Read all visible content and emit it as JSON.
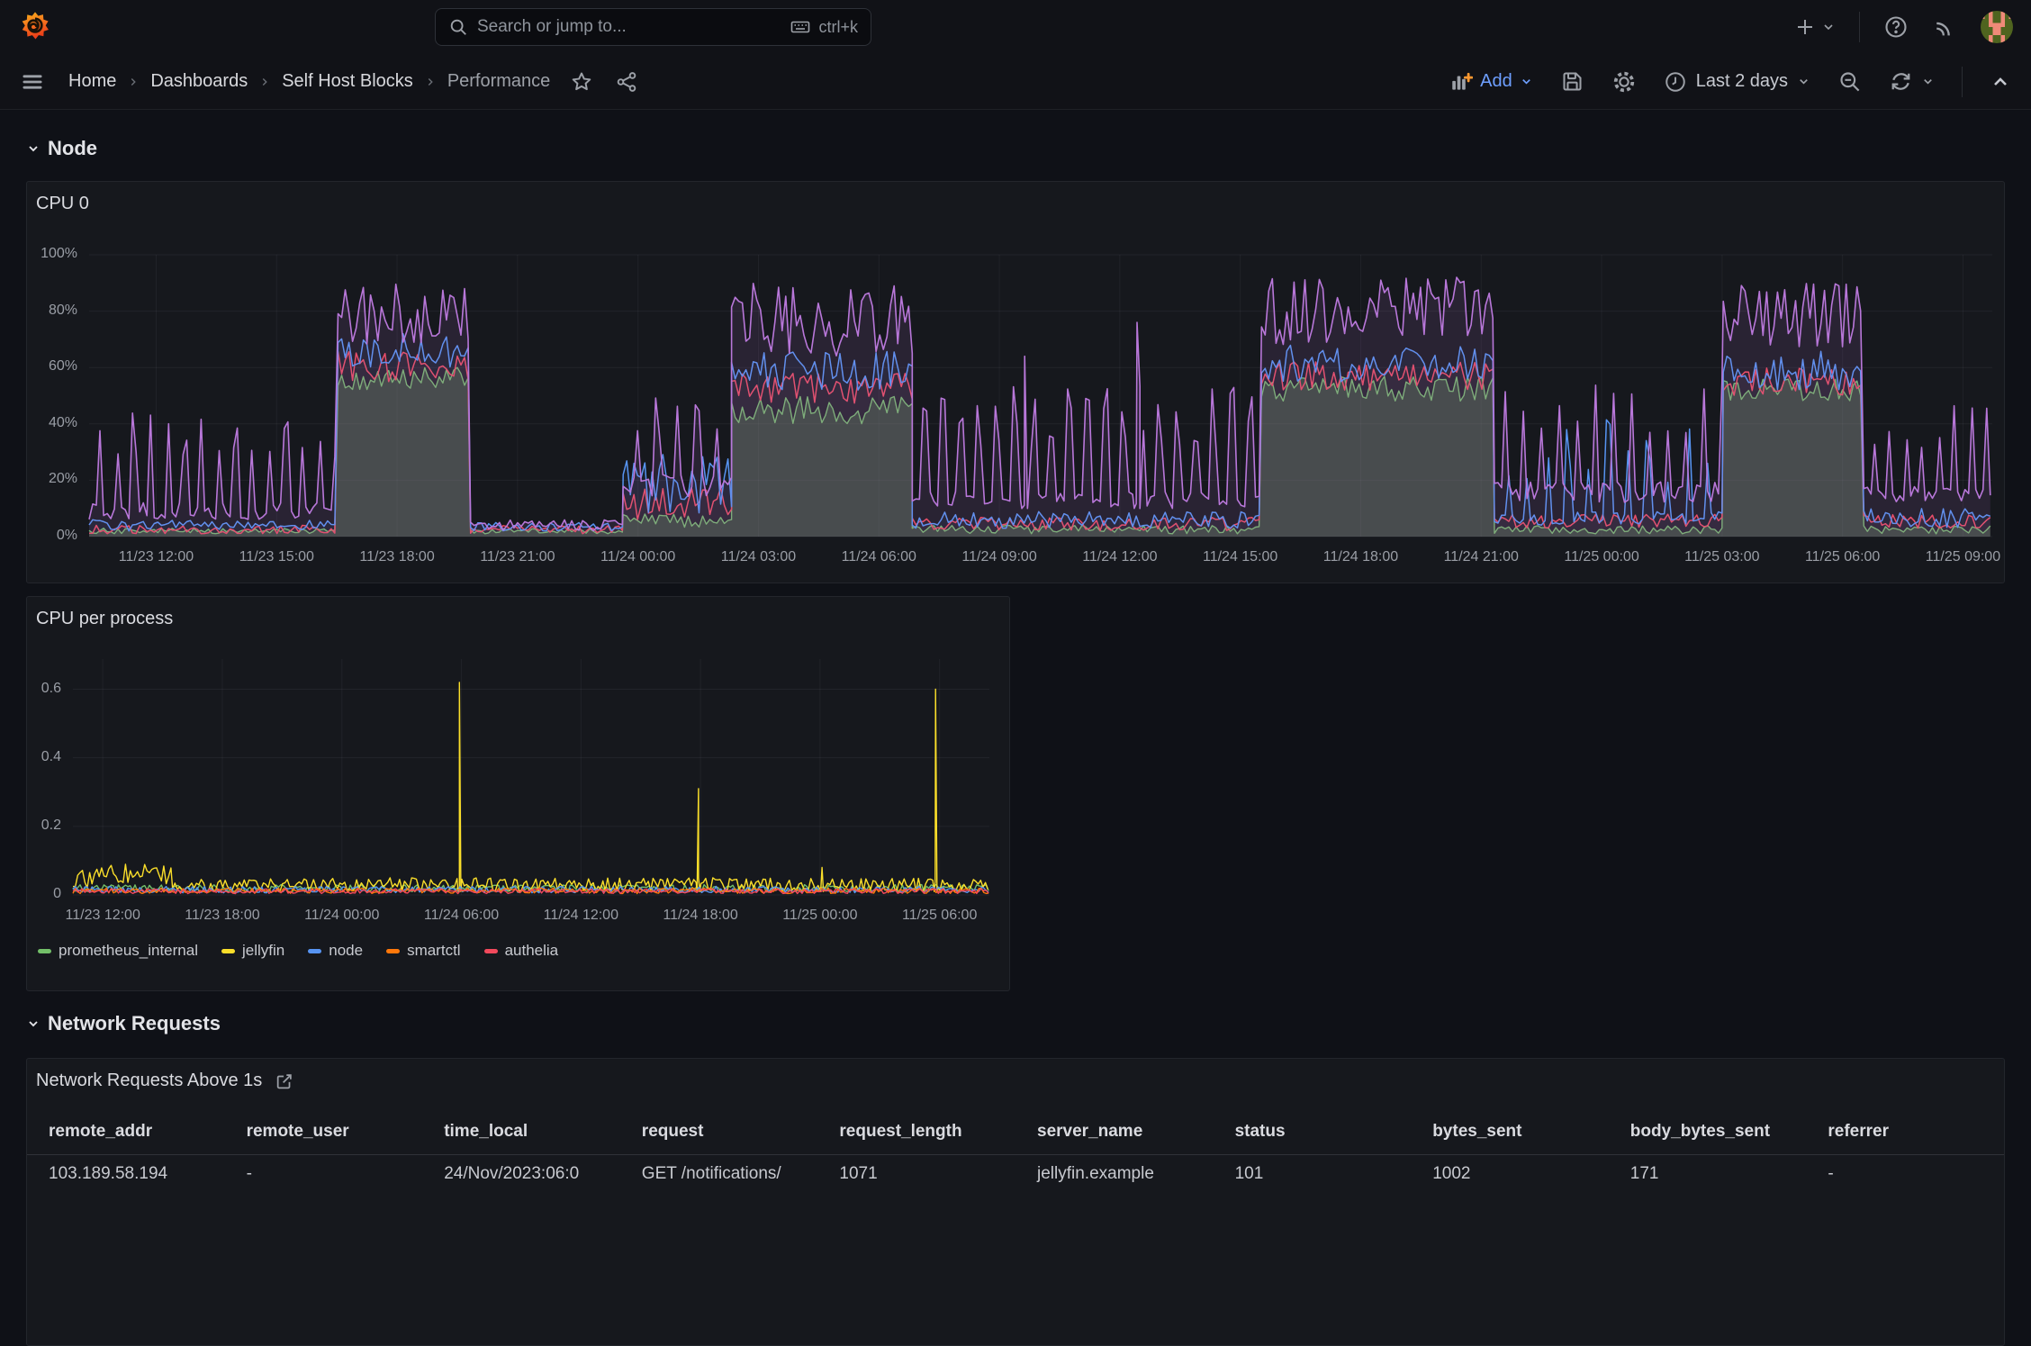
{
  "topbar": {
    "search_placeholder": "Search or jump to...",
    "search_shortcut": "ctrl+k"
  },
  "toolbar": {
    "breadcrumb": [
      "Home",
      "Dashboards",
      "Self Host Blocks",
      "Performance"
    ],
    "add_label": "Add",
    "time_range_label": "Last 2 days"
  },
  "sections": {
    "node": "Node",
    "network": "Network Requests"
  },
  "colors": {
    "accent_blue": "#6e9fff",
    "series_green": "#73BF69",
    "series_yellow": "#FADE2A",
    "series_blue": "#5794F2",
    "series_orange": "#FF780A",
    "series_red": "#F2495C",
    "series_purple": "#B877D9"
  },
  "chart_data": [
    {
      "name": "cpu0",
      "title": "CPU 0",
      "type": "area",
      "xlim": [
        0,
        47.4
      ],
      "ylim": [
        0,
        100
      ],
      "dt": 0.09,
      "grid": true,
      "yticks": [
        {
          "v": 0,
          "label": "0%"
        },
        {
          "v": 20,
          "label": "20%"
        },
        {
          "v": 40,
          "label": "40%"
        },
        {
          "v": 60,
          "label": "60%"
        },
        {
          "v": 80,
          "label": "80%"
        },
        {
          "v": 100,
          "label": "100%"
        }
      ],
      "xticks": [
        {
          "h": 1.67,
          "label": "11/23 12:00"
        },
        {
          "h": 4.67,
          "label": "11/23 15:00"
        },
        {
          "h": 7.67,
          "label": "11/23 18:00"
        },
        {
          "h": 10.67,
          "label": "11/23 21:00"
        },
        {
          "h": 13.67,
          "label": "11/24 00:00"
        },
        {
          "h": 16.67,
          "label": "11/24 03:00"
        },
        {
          "h": 19.67,
          "label": "11/24 06:00"
        },
        {
          "h": 22.67,
          "label": "11/24 09:00"
        },
        {
          "h": 25.67,
          "label": "11/24 12:00"
        },
        {
          "h": 28.67,
          "label": "11/24 15:00"
        },
        {
          "h": 31.67,
          "label": "11/24 18:00"
        },
        {
          "h": 34.67,
          "label": "11/24 21:00"
        },
        {
          "h": 37.67,
          "label": "11/25 00:00"
        },
        {
          "h": 40.67,
          "label": "11/25 03:00"
        },
        {
          "h": 43.67,
          "label": "11/25 06:00"
        },
        {
          "h": 46.67,
          "label": "11/25 09:00"
        }
      ],
      "series": [
        {
          "name": "idle-inverse-green",
          "color": "#73BF69",
          "fill": 0.25,
          "width": 1.4,
          "segments": [
            {
              "t0": 0,
              "t1": 6.2,
              "type": "band",
              "lo": 1,
              "hi": 3
            },
            {
              "t0": 6.2,
              "t1": 9.5,
              "type": "band",
              "lo": 52,
              "hi": 60
            },
            {
              "t0": 9.5,
              "t1": 13.3,
              "type": "band",
              "lo": 1,
              "hi": 3
            },
            {
              "t0": 13.3,
              "t1": 16,
              "type": "band",
              "lo": 3,
              "hi": 8
            },
            {
              "t0": 16,
              "t1": 20.5,
              "type": "band",
              "lo": 40,
              "hi": 50
            },
            {
              "t0": 20.5,
              "t1": 29.2,
              "type": "band",
              "lo": 1,
              "hi": 4
            },
            {
              "t0": 29.2,
              "t1": 35,
              "type": "band",
              "lo": 48,
              "hi": 57
            },
            {
              "t0": 35,
              "t1": 40.7,
              "type": "band",
              "lo": 1,
              "hi": 4
            },
            {
              "t0": 40.7,
              "t1": 44.2,
              "type": "band",
              "lo": 48,
              "hi": 56
            },
            {
              "t0": 44.2,
              "t1": 47.4,
              "type": "band",
              "lo": 1,
              "hi": 4
            }
          ]
        },
        {
          "name": "user-red",
          "color": "#F2495C",
          "fill": 0.06,
          "width": 1.5,
          "segments": [
            {
              "t0": 0,
              "t1": 6.2,
              "type": "band",
              "lo": 1,
              "hi": 4
            },
            {
              "t0": 6.2,
              "t1": 9.5,
              "type": "band",
              "lo": 55,
              "hi": 66
            },
            {
              "t0": 9.5,
              "t1": 13.3,
              "type": "band",
              "lo": 1,
              "hi": 4
            },
            {
              "t0": 13.3,
              "t1": 16,
              "type": "band",
              "lo": 5,
              "hi": 18
            },
            {
              "t0": 16,
              "t1": 20.5,
              "type": "band",
              "lo": 47,
              "hi": 58
            },
            {
              "t0": 20.5,
              "t1": 29.2,
              "type": "band",
              "lo": 2,
              "hi": 7
            },
            {
              "t0": 29.2,
              "t1": 35,
              "type": "band",
              "lo": 52,
              "hi": 62
            },
            {
              "t0": 35,
              "t1": 40.7,
              "type": "band",
              "lo": 3,
              "hi": 8
            },
            {
              "t0": 40.7,
              "t1": 44.2,
              "type": "band",
              "lo": 50,
              "hi": 60
            },
            {
              "t0": 44.2,
              "t1": 47.4,
              "type": "band",
              "lo": 3,
              "hi": 8
            }
          ]
        },
        {
          "name": "system-blue",
          "color": "#5794F2",
          "fill": 0.06,
          "width": 1.5,
          "segments": [
            {
              "t0": 0,
              "t1": 6.2,
              "type": "band",
              "lo": 2,
              "hi": 6
            },
            {
              "t0": 6.2,
              "t1": 9.5,
              "type": "band",
              "lo": 60,
              "hi": 72
            },
            {
              "t0": 9.5,
              "t1": 13.3,
              "type": "band",
              "lo": 2,
              "hi": 5
            },
            {
              "t0": 13.3,
              "t1": 16,
              "type": "band",
              "lo": 8,
              "hi": 30
            },
            {
              "t0": 16,
              "t1": 20.5,
              "type": "band",
              "lo": 52,
              "hi": 66
            },
            {
              "t0": 20.5,
              "t1": 29.2,
              "type": "band",
              "lo": 3,
              "hi": 9
            },
            {
              "t0": 29.2,
              "t1": 35,
              "type": "band",
              "lo": 55,
              "hi": 68
            },
            {
              "t0": 35,
              "t1": 40.7,
              "type": "teeth",
              "lo": 4,
              "hi": 9,
              "period": 0.5,
              "pk": [
                18,
                42
              ]
            },
            {
              "t0": 40.7,
              "t1": 44.2,
              "type": "band",
              "lo": 52,
              "hi": 66
            },
            {
              "t0": 44.2,
              "t1": 47.4,
              "type": "band",
              "lo": 3,
              "hi": 10
            }
          ]
        },
        {
          "name": "iowait-purple",
          "color": "#B877D9",
          "fill": 0.12,
          "width": 1.6,
          "segments": [
            {
              "t0": 0,
              "t1": 6.2,
              "type": "teeth",
              "lo": 6,
              "hi": 12,
              "period": 0.42,
              "pk": [
                28,
                44
              ]
            },
            {
              "t0": 6.2,
              "t1": 9.5,
              "type": "band",
              "lo": 68,
              "hi": 90
            },
            {
              "t0": 9.5,
              "t1": 13.3,
              "type": "band",
              "lo": 2,
              "hi": 6
            },
            {
              "t0": 13.3,
              "t1": 16,
              "type": "teeth",
              "lo": 14,
              "hi": 22,
              "period": 0.5,
              "pk": [
                34,
                56
              ]
            },
            {
              "t0": 16,
              "t1": 20.5,
              "type": "band",
              "lo": 64,
              "hi": 90
            },
            {
              "t0": 20.5,
              "t1": 29.2,
              "type": "teeth",
              "lo": 10,
              "hi": 16,
              "period": 0.45,
              "pk": [
                32,
                54
              ],
              "spikes": [
                [
                  23.3,
                  64
                ],
                [
                  26.1,
                  76
                ]
              ]
            },
            {
              "t0": 29.2,
              "t1": 35,
              "type": "band",
              "lo": 68,
              "hi": 92
            },
            {
              "t0": 35,
              "t1": 40.7,
              "type": "teeth",
              "lo": 12,
              "hi": 20,
              "period": 0.45,
              "pk": [
                35,
                56
              ]
            },
            {
              "t0": 40.7,
              "t1": 44.2,
              "type": "band",
              "lo": 66,
              "hi": 90
            },
            {
              "t0": 44.2,
              "t1": 47.4,
              "type": "teeth",
              "lo": 12,
              "hi": 18,
              "period": 0.4,
              "pk": [
                30,
                50
              ]
            }
          ]
        }
      ]
    },
    {
      "name": "cpu_per_process",
      "title": "CPU per process",
      "type": "line",
      "xlim": [
        0,
        46
      ],
      "ylim": [
        0,
        0.688
      ],
      "dt": 0.12,
      "grid": true,
      "yticks": [
        {
          "v": 0,
          "label": "0"
        },
        {
          "v": 0.2,
          "label": "0.2"
        },
        {
          "v": 0.4,
          "label": "0.4"
        },
        {
          "v": 0.6,
          "label": "0.6"
        }
      ],
      "xticks": [
        {
          "h": 1.5,
          "label": "11/23 12:00"
        },
        {
          "h": 7.5,
          "label": "11/23 18:00"
        },
        {
          "h": 13.5,
          "label": "11/24 00:00"
        },
        {
          "h": 19.5,
          "label": "11/24 06:00"
        },
        {
          "h": 25.5,
          "label": "11/24 12:00"
        },
        {
          "h": 31.5,
          "label": "11/24 18:00"
        },
        {
          "h": 37.5,
          "label": "11/25 00:00"
        },
        {
          "h": 43.5,
          "label": "11/25 06:00"
        }
      ],
      "series": [
        {
          "name": "prometheus_internal",
          "legend": true,
          "color": "#73BF69",
          "fill": 0,
          "width": 1.4,
          "segments": [
            {
              "t0": 0,
              "t1": 46,
              "type": "band",
              "lo": 0.008,
              "hi": 0.03
            }
          ]
        },
        {
          "name": "jellyfin",
          "legend": true,
          "color": "#FADE2A",
          "fill": 0,
          "width": 1.4,
          "segments": [
            {
              "t0": 0,
              "t1": 5,
              "type": "band",
              "lo": 0.02,
              "hi": 0.09
            },
            {
              "t0": 5,
              "t1": 46,
              "type": "band",
              "lo": 0.01,
              "hi": 0.05,
              "spikes": [
                [
                  19.4,
                  0.62
                ],
                [
                  31.4,
                  0.31
                ],
                [
                  37.6,
                  0.08
                ],
                [
                  43.3,
                  0.6
                ]
              ]
            }
          ]
        },
        {
          "name": "node",
          "legend": true,
          "color": "#5794F2",
          "fill": 0,
          "width": 1.4,
          "segments": [
            {
              "t0": 0,
              "t1": 46,
              "type": "band",
              "lo": 0.006,
              "hi": 0.025
            }
          ]
        },
        {
          "name": "smartctl",
          "legend": true,
          "color": "#FF780A",
          "fill": 0,
          "width": 1.4,
          "segments": [
            {
              "t0": 0,
              "t1": 46,
              "type": "band",
              "lo": 0.004,
              "hi": 0.02
            }
          ]
        },
        {
          "name": "authelia",
          "legend": true,
          "color": "#F2495C",
          "fill": 0,
          "width": 1.4,
          "segments": [
            {
              "t0": 0,
              "t1": 46,
              "type": "band",
              "lo": 0.004,
              "hi": 0.018
            }
          ]
        }
      ]
    }
  ],
  "panels": {
    "table_title": "Network Requests Above 1s"
  },
  "table": {
    "columns": [
      "remote_addr",
      "remote_user",
      "time_local",
      "request",
      "request_length",
      "server_name",
      "status",
      "bytes_sent",
      "body_bytes_sent",
      "referrer"
    ],
    "partial_row": [
      "103.189.58.194",
      "-",
      "24/Nov/2023:06:0",
      "GET /notifications/",
      "1071",
      "jellyfin.example",
      "101",
      "1002",
      "171",
      "-"
    ]
  }
}
